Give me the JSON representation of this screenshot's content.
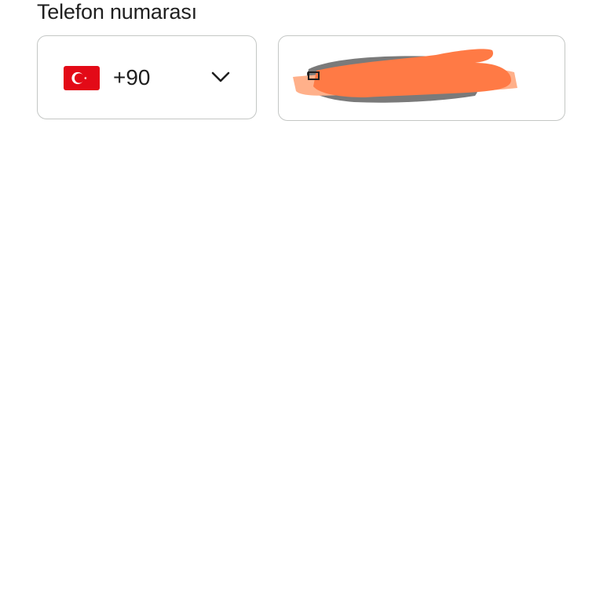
{
  "form": {
    "phone_label": "Telefon numarası",
    "country": {
      "dial_code": "+90",
      "flag_icon": "turkey-flag-icon",
      "dropdown_icon": "chevron-down-icon"
    },
    "phone_number": {
      "value": "5"
    }
  },
  "colors": {
    "border": "#c4c7c5",
    "text": "#1f1f1f",
    "flag_red": "#e30a17",
    "redaction_orange": "#ff7a45",
    "redaction_light_orange": "#ffb08a",
    "redaction_gray": "#7a7a7a"
  }
}
